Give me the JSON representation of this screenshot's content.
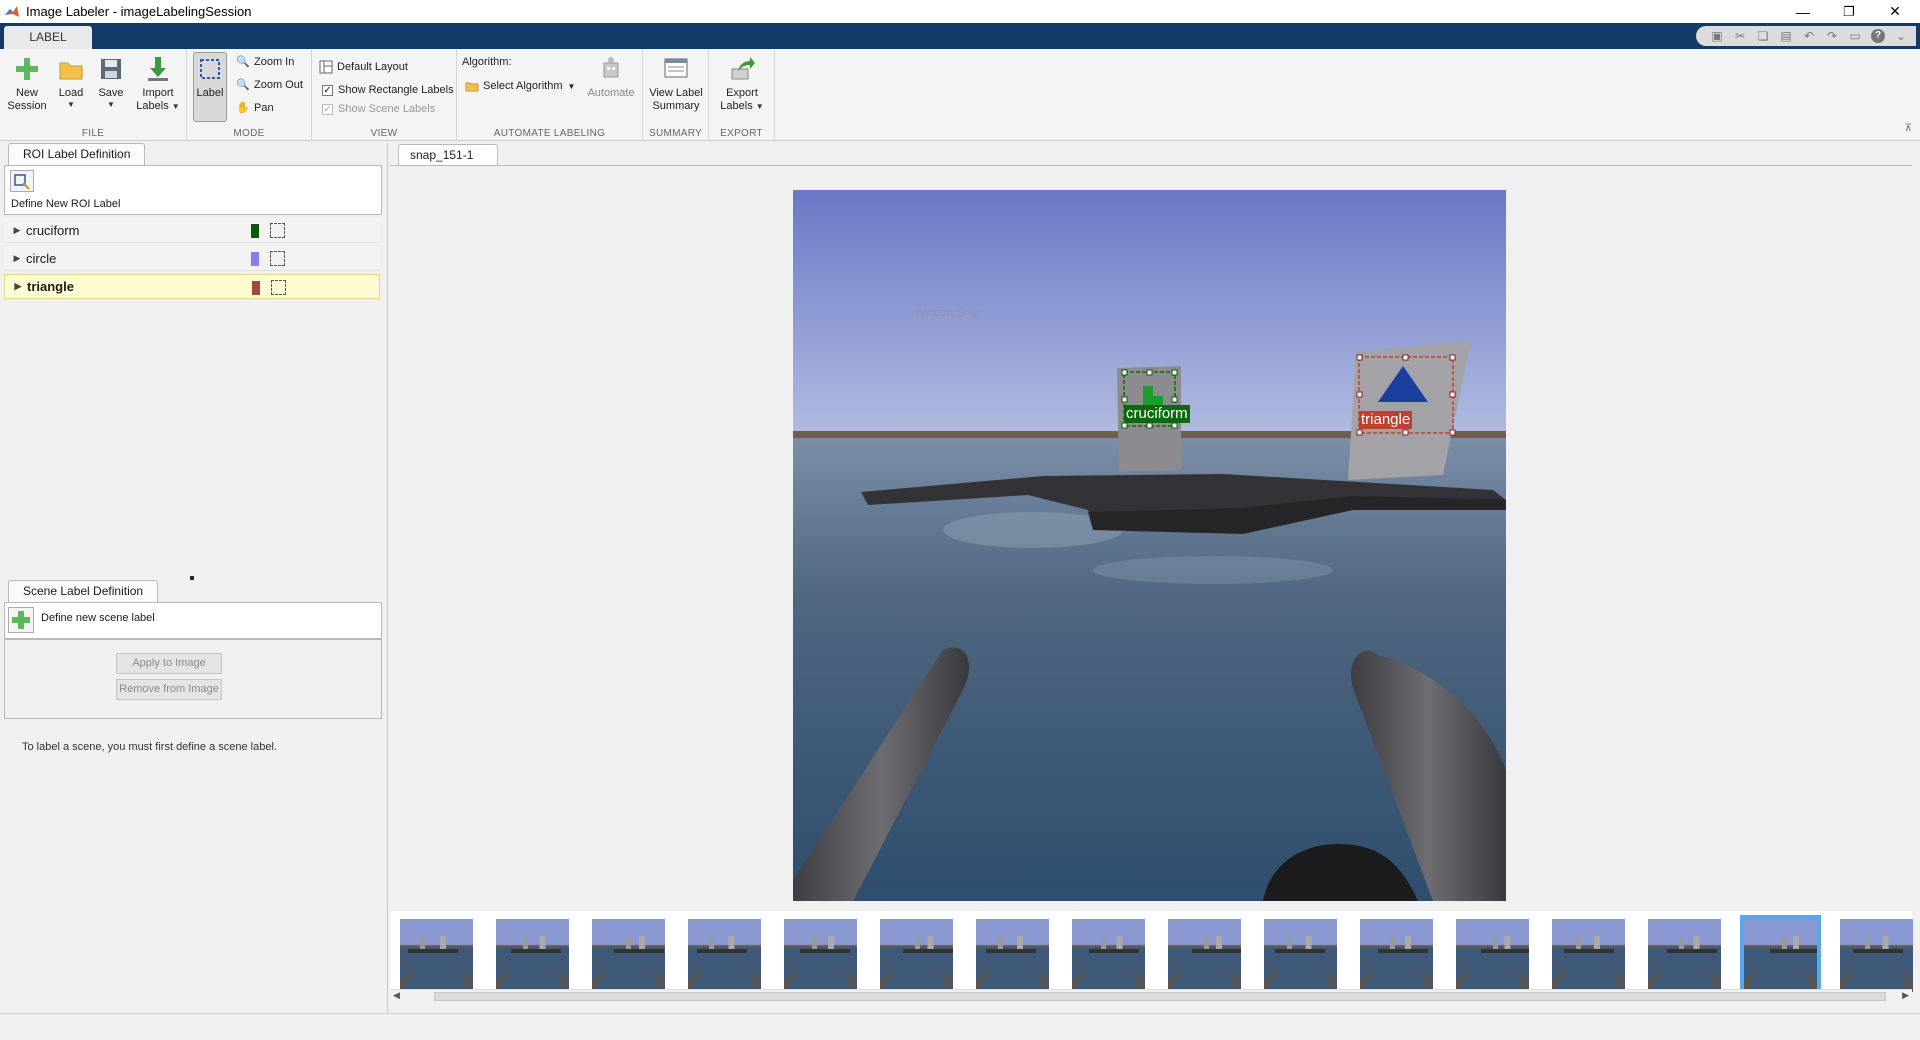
{
  "window": {
    "title": "Image Labeler - imageLabelingSession",
    "controls": {
      "minimize": "—",
      "restore": "❐",
      "close": "✕"
    }
  },
  "ribbon_tab": "LABEL",
  "quick_access": {
    "help": "?"
  },
  "ribbon": {
    "file": {
      "title": "FILE",
      "new_session": "New Session",
      "load": "Load",
      "save": "Save",
      "import_labels": "Import Labels"
    },
    "mode": {
      "title": "MODE",
      "label": "Label",
      "zoom_in": "Zoom In",
      "zoom_out": "Zoom Out",
      "pan": "Pan"
    },
    "view": {
      "title": "VIEW",
      "default_layout": "Default Layout",
      "show_rectangle_labels": "Show Rectangle Labels",
      "show_scene_labels": "Show Scene Labels",
      "show_rectangle_labels_checked": true,
      "show_scene_labels_checked": true
    },
    "automate": {
      "title": "AUTOMATE LABELING",
      "algorithm_label": "Algorithm:",
      "select_algorithm": "Select Algorithm",
      "automate": "Automate"
    },
    "summary": {
      "title": "SUMMARY",
      "view_label_summary": "View Label Summary"
    },
    "export": {
      "title": "EXPORT",
      "export_labels": "Export Labels"
    }
  },
  "roi_panel": {
    "tab": "ROI Label Definition",
    "define_new": "Define New ROI Label",
    "labels": [
      {
        "name": "cruciform",
        "color": "#0b5a0b",
        "selected": false
      },
      {
        "name": "circle",
        "color": "#8080f0",
        "selected": false
      },
      {
        "name": "triangle",
        "color": "#a0483a",
        "selected": true
      }
    ]
  },
  "scene_panel": {
    "tab": "Scene Label Definition",
    "define_new": "Define new scene label",
    "apply": "Apply to Image",
    "remove": "Remove from Image",
    "hint": "To label a scene, you must first define a scene label."
  },
  "document": {
    "tab": "snap_151-1",
    "watermark": "Window Snip",
    "annotations": [
      {
        "label": "cruciform",
        "color": "#0b6a0b"
      },
      {
        "label": "triangle",
        "color": "#c04030"
      }
    ]
  },
  "filmstrip": {
    "thumb_count": 16,
    "selected_index": 14
  }
}
